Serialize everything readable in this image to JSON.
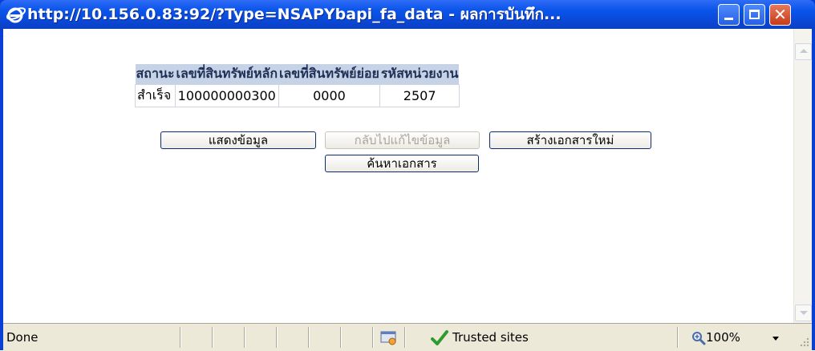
{
  "window": {
    "title": "http://10.156.0.83:92/?Type=NSAPYbapi_fa_data - ผลการบันทึก..."
  },
  "table": {
    "headers": [
      "สถานะ",
      "เลขที่สินทรัพย์หลัก",
      "เลขที่สินทรัพย์ย่อย",
      "รหัสหน่วยงาน"
    ],
    "rows": [
      [
        "สำเร็จ",
        "100000000300",
        "0000",
        "2507"
      ]
    ]
  },
  "buttons": {
    "show_data": "แสดงข้อมูล",
    "back_edit": "กลับไปแก้ไขข้อมูล",
    "new_document": "สร้างเอกสารใหม่",
    "find_document": "ค้นหาเอกสาร"
  },
  "statusbar": {
    "status": "Done",
    "zone": "Trusted sites",
    "zoom": "100%"
  },
  "colors": {
    "titlebar": "#0b55ea",
    "table_header": "#c6d3e6",
    "close_button": "#c73a17"
  },
  "icons": {
    "title": "ie-logo-icon",
    "zone": "security-zone-icon",
    "trusted": "checkmark-icon",
    "zoom": "magnifier-icon"
  }
}
